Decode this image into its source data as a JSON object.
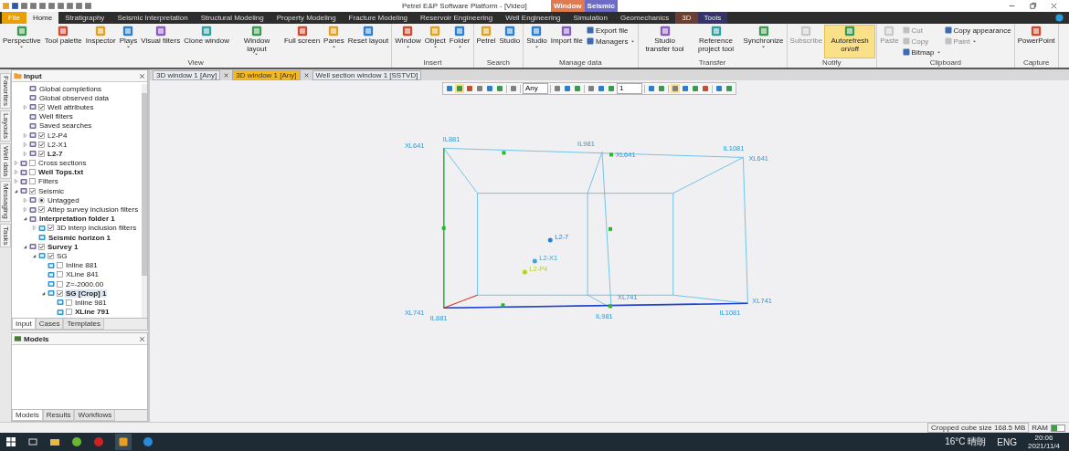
{
  "title_bar": {
    "title": "Petrel E&P Software Platform - [Video]",
    "context_tabs": [
      {
        "label": "Window",
        "color": "#e07a50"
      },
      {
        "label": "Seismic",
        "color": "#6c6cc8"
      }
    ]
  },
  "ribbon_tabs": [
    {
      "label": "File",
      "kind": "file",
      "selected": false
    },
    {
      "label": "Home",
      "kind": "normal",
      "selected": true
    },
    {
      "label": "Stratigraphy",
      "kind": "normal",
      "selected": false
    },
    {
      "label": "Seismic Interpretation",
      "kind": "normal",
      "selected": false
    },
    {
      "label": "Structural Modeling",
      "kind": "normal",
      "selected": false
    },
    {
      "label": "Property Modeling",
      "kind": "normal",
      "selected": false
    },
    {
      "label": "Fracture Modeling",
      "kind": "normal",
      "selected": false
    },
    {
      "label": "Reservoir Engineering",
      "kind": "normal",
      "selected": false
    },
    {
      "label": "Well Engineering",
      "kind": "normal",
      "selected": false
    },
    {
      "label": "Simulation",
      "kind": "normal",
      "selected": false
    },
    {
      "label": "Geomechanics",
      "kind": "normal",
      "selected": false
    },
    {
      "label": "3D",
      "kind": "context",
      "color": "#6a3e30",
      "selected": false
    },
    {
      "label": "Tools",
      "kind": "context",
      "color": "#34346a",
      "selected": false
    }
  ],
  "ribbon_groups": [
    {
      "label": "View",
      "buttons": [
        {
          "kind": "large",
          "label": "Perspective",
          "dropdown": true,
          "disabled": false,
          "active": false
        },
        {
          "kind": "large",
          "label": "Tool palette",
          "dropdown": false,
          "disabled": false,
          "active": false
        },
        {
          "kind": "large",
          "label": "Inspector",
          "dropdown": false,
          "disabled": false,
          "active": false
        },
        {
          "kind": "large",
          "label": "Plays",
          "dropdown": true,
          "disabled": false,
          "active": false
        },
        {
          "kind": "large",
          "label": "Visual filters",
          "dropdown": false,
          "disabled": false,
          "active": false
        },
        {
          "kind": "large",
          "label": "Clone window",
          "dropdown": false,
          "disabled": false,
          "active": false
        },
        {
          "kind": "large",
          "label": "Window layout",
          "dropdown": true,
          "disabled": false,
          "active": false
        },
        {
          "kind": "large",
          "label": "Full screen",
          "dropdown": false,
          "disabled": false,
          "active": false
        },
        {
          "kind": "large",
          "label": "Panes",
          "dropdown": true,
          "disabled": false,
          "active": false
        },
        {
          "kind": "large",
          "label": "Reset layout",
          "dropdown": false,
          "disabled": false,
          "active": false
        }
      ]
    },
    {
      "label": "Insert",
      "buttons": [
        {
          "kind": "large",
          "label": "Window",
          "dropdown": true,
          "disabled": false,
          "active": false
        },
        {
          "kind": "large",
          "label": "Object",
          "dropdown": true,
          "disabled": false,
          "active": false
        },
        {
          "kind": "large",
          "label": "Folder",
          "dropdown": true,
          "disabled": false,
          "active": false
        }
      ]
    },
    {
      "label": "Search",
      "buttons": [
        {
          "kind": "large",
          "label": "Petrel",
          "dropdown": false,
          "disabled": false,
          "active": false
        },
        {
          "kind": "large",
          "label": "Studio",
          "dropdown": false,
          "disabled": false,
          "active": false
        }
      ]
    },
    {
      "label": "Manage data",
      "buttons": [
        {
          "kind": "large",
          "label": "Studio",
          "dropdown": true,
          "disabled": false,
          "active": false
        },
        {
          "kind": "large",
          "label": "Import file",
          "dropdown": false,
          "disabled": false,
          "active": false
        },
        {
          "kind": "stack",
          "items": [
            {
              "label": "Export file",
              "dropdown": false,
              "disabled": false
            },
            {
              "label": "Managers",
              "dropdown": true,
              "disabled": false
            }
          ]
        }
      ]
    },
    {
      "label": "Transfer",
      "buttons": [
        {
          "kind": "large",
          "label": "Studio transfer tool",
          "dropdown": false,
          "disabled": false,
          "active": false
        },
        {
          "kind": "large",
          "label": "Reference project tool",
          "dropdown": false,
          "disabled": false,
          "active": false
        },
        {
          "kind": "large",
          "label": "Synchronize",
          "dropdown": true,
          "disabled": false,
          "active": false
        }
      ]
    },
    {
      "label": "Notify",
      "buttons": [
        {
          "kind": "large",
          "label": "Subscribe",
          "dropdown": false,
          "disabled": true,
          "active": false
        },
        {
          "kind": "large",
          "label": "Autorefresh on/off",
          "dropdown": false,
          "disabled": false,
          "active": true
        }
      ]
    },
    {
      "label": "Clipboard",
      "buttons": [
        {
          "kind": "large",
          "label": "Paste",
          "dropdown": false,
          "disabled": true,
          "active": false
        },
        {
          "kind": "stack",
          "items": [
            {
              "label": "Cut",
              "dropdown": false,
              "disabled": true
            },
            {
              "label": "Copy",
              "dropdown": false,
              "disabled": true
            },
            {
              "label": "Bitmap",
              "dropdown": true,
              "disabled": false
            }
          ]
        },
        {
          "kind": "stack",
          "items": [
            {
              "label": "Copy appearance",
              "dropdown": false,
              "disabled": false
            },
            {
              "label": "Paint",
              "dropdown": true,
              "disabled": true
            }
          ]
        }
      ]
    },
    {
      "label": "Capture",
      "buttons": [
        {
          "kind": "large",
          "label": "PowerPoint",
          "dropdown": false,
          "disabled": false,
          "active": false
        }
      ]
    }
  ],
  "side_strip": [
    {
      "label": "Favorites"
    },
    {
      "label": "Layouts"
    },
    {
      "label": "Well data"
    },
    {
      "label": "Messaging"
    },
    {
      "label": "Tasks"
    }
  ],
  "input_panel": {
    "title": "Input",
    "tree": {
      "continued_children": [
        {
          "label": "Global completions",
          "kind": "plain",
          "active": false,
          "selected": false
        },
        {
          "label": "Global observed data",
          "kind": "plain",
          "active": false,
          "selected": false
        },
        {
          "label": "Well attributes",
          "kind": "check",
          "checked": true,
          "expanded": false,
          "active": false,
          "selected": false
        },
        {
          "label": "Well filters",
          "kind": "plain",
          "active": false,
          "selected": false
        },
        {
          "label": "Saved searches",
          "kind": "plain",
          "active": false,
          "selected": false
        },
        {
          "label": "L2-P4",
          "kind": "check",
          "checked": true,
          "expanded": false,
          "active": false,
          "selected": false
        },
        {
          "label": "L2-X1",
          "kind": "check",
          "checked": true,
          "expanded": false,
          "active": false,
          "selected": false
        },
        {
          "label": "L2-7",
          "kind": "check",
          "checked": true,
          "expanded": false,
          "active": true,
          "selected": false
        }
      ],
      "items": [
        {
          "label": "Cross sections",
          "kind": "check",
          "checked": false,
          "expanded": false,
          "active": false,
          "selected": false
        },
        {
          "label": "Well Tops.txt",
          "kind": "check",
          "checked": false,
          "expanded": false,
          "active": true,
          "selected": false
        },
        {
          "label": "Filters",
          "kind": "check",
          "checked": false,
          "expanded": false,
          "active": false,
          "selected": false
        },
        {
          "label": "Seismic",
          "kind": "check",
          "checked": true,
          "expanded": true,
          "active": false,
          "selected": false,
          "children": [
            {
              "label": "Untagged",
              "kind": "radio",
              "checked": true,
              "expanded": false,
              "active": false,
              "selected": false
            },
            {
              "label": "Attep survey inclusion filters",
              "kind": "check",
              "checked": true,
              "expanded": false,
              "active": false,
              "selected": false
            },
            {
              "label": "Interpretation folder 1",
              "kind": "plain",
              "expanded": true,
              "active": true,
              "selected": false,
              "children": [
                {
                  "label": "3D interp inclusion filters",
                  "kind": "check",
                  "checked": true,
                  "expanded": false,
                  "active": false,
                  "selected": false
                },
                {
                  "label": "Seismic horizon 1",
                  "kind": "plain",
                  "active": true,
                  "selected": false
                }
              ]
            },
            {
              "label": "Survey 1",
              "kind": "check",
              "checked": true,
              "expanded": true,
              "active": true,
              "selected": false,
              "children": [
                {
                  "label": "SG",
                  "kind": "check",
                  "checked": true,
                  "expanded": true,
                  "active": false,
                  "selected": false,
                  "children": [
                    {
                      "label": "Inline 881",
                      "kind": "check",
                      "checked": false,
                      "active": false,
                      "selected": false
                    },
                    {
                      "label": "XLine 841",
                      "kind": "check",
                      "checked": false,
                      "active": false,
                      "selected": false
                    },
                    {
                      "label": "Z=-2000.00",
                      "kind": "check",
                      "checked": false,
                      "active": false,
                      "selected": false
                    },
                    {
                      "label": "SG [Crop] 1",
                      "kind": "check",
                      "checked": true,
                      "expanded": true,
                      "active": true,
                      "selected": true,
                      "children": [
                        {
                          "label": "Inline 981",
                          "kind": "check",
                          "checked": false,
                          "active": false,
                          "selected": false
                        },
                        {
                          "label": "XLine 791",
                          "kind": "check",
                          "checked": false,
                          "active": true,
                          "selected": false
                        }
                      ]
                    }
                  ]
                }
              ]
            }
          ]
        }
      ]
    },
    "tabs": [
      {
        "label": "Input",
        "selected": true
      },
      {
        "label": "Cases",
        "selected": false
      },
      {
        "label": "Templates",
        "selected": false
      }
    ]
  },
  "models_panel": {
    "title": "Models",
    "tabs": [
      {
        "label": "Models",
        "selected": true
      },
      {
        "label": "Results",
        "selected": false
      },
      {
        "label": "Workflows",
        "selected": false
      }
    ]
  },
  "window_tabs": [
    {
      "label": "3D window 1 [Any]",
      "selected": false
    },
    {
      "label": "3D window 1 [Any]",
      "selected": true
    },
    {
      "label": "Well section window 1 [SSTVD]",
      "selected": false
    }
  ],
  "toolbar": [
    {
      "kind": "button",
      "selected": false
    },
    {
      "kind": "button",
      "selected": true
    },
    {
      "kind": "button",
      "selected": false
    },
    {
      "kind": "button",
      "selected": false
    },
    {
      "kind": "button",
      "selected": false
    },
    {
      "kind": "button",
      "selected": false
    },
    {
      "kind": "separator"
    },
    {
      "kind": "button",
      "selected": false
    },
    {
      "kind": "separator"
    },
    {
      "kind": "dropdown",
      "value": "Any"
    },
    {
      "kind": "separator"
    },
    {
      "kind": "button",
      "selected": false
    },
    {
      "kind": "button",
      "selected": false
    },
    {
      "kind": "button",
      "selected": false
    },
    {
      "kind": "separator"
    },
    {
      "kind": "button",
      "selected": false
    },
    {
      "kind": "button",
      "selected": false
    },
    {
      "kind": "button",
      "selected": false
    },
    {
      "kind": "dropdown",
      "value": "1"
    },
    {
      "kind": "separator"
    },
    {
      "kind": "button",
      "selected": false
    },
    {
      "kind": "button",
      "selected": false
    },
    {
      "kind": "separator"
    },
    {
      "kind": "button",
      "selected": true
    },
    {
      "kind": "button",
      "selected": false
    },
    {
      "kind": "button",
      "selected": false
    },
    {
      "kind": "button",
      "selected": false
    },
    {
      "kind": "separator"
    },
    {
      "kind": "button",
      "selected": false
    },
    {
      "kind": "button",
      "selected": false
    }
  ],
  "scene": {
    "corner_labels": [
      "XL641",
      "IL881",
      "IL981",
      "XL641",
      "IL1081",
      "XL641",
      "XL741",
      "IL881",
      "XL741",
      "IL981",
      "XL741",
      "IL1081"
    ],
    "wells": [
      {
        "name": "L2-7",
        "color": "#2a7fd0"
      },
      {
        "name": "L2-X1",
        "color": "#30a8d8"
      },
      {
        "name": "L2-P4",
        "color": "#b8d020"
      }
    ]
  },
  "status_bar": {
    "text": "Cropped cube size 168.5 MB",
    "ram_label": "RAM",
    "ram_meter": {
      "level": 0.45
    }
  },
  "taskbar": {
    "weather": "16°C 晴朗",
    "language": "ENG",
    "time": "20:06",
    "date": "2021/11/4"
  }
}
